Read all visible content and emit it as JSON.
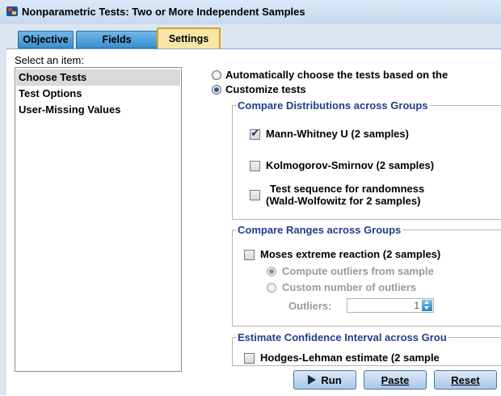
{
  "window": {
    "title": "Nonparametric Tests: Two or More Independent Samples",
    "icon": "spss-app-icon"
  },
  "tabs": [
    {
      "label": "Objective",
      "active": false
    },
    {
      "label": "Fields",
      "active": false
    },
    {
      "label": "Settings",
      "active": true
    }
  ],
  "left_panel": {
    "select_label": "Select an item:",
    "items": [
      {
        "label": "Choose Tests",
        "selected": true
      },
      {
        "label": "Test Options",
        "selected": false
      },
      {
        "label": "User-Missing Values",
        "selected": false
      }
    ]
  },
  "mode": {
    "auto_label": "Automatically choose the tests based on the",
    "auto_selected": false,
    "custom_label": "Customize tests",
    "custom_selected": true
  },
  "compare_distributions": {
    "title": "Compare Distributions across Groups",
    "mann_whitney_label": "Mann-Whitney U (2 samples)",
    "mann_whitney_checked": true,
    "kolmogorov_label": "Kolmogorov-Smirnov (2 samples)",
    "kolmogorov_checked": false,
    "test_sequence_line1": "Test sequence for randomness",
    "test_sequence_line2": "(Wald-Wolfowitz for 2 samples)",
    "test_sequence_checked": false
  },
  "compare_ranges": {
    "title": "Compare Ranges across Groups",
    "moses_label": "Moses extreme reaction (2 samples)",
    "moses_checked": false,
    "compute_outliers_label": "Compute outliers from sample",
    "compute_outliers_selected": true,
    "custom_outliers_label": "Custom number of outliers",
    "custom_outliers_selected": false,
    "outliers_label": "Outliers:",
    "outliers_value": "1"
  },
  "estimate_ci": {
    "title": "Estimate Confidence Interval across Grou",
    "hodges_label": "Hodges-Lehman estimate (2 sample",
    "hodges_checked": false
  },
  "buttons": {
    "run": "Run",
    "paste": "Paste",
    "reset": "Reset"
  }
}
